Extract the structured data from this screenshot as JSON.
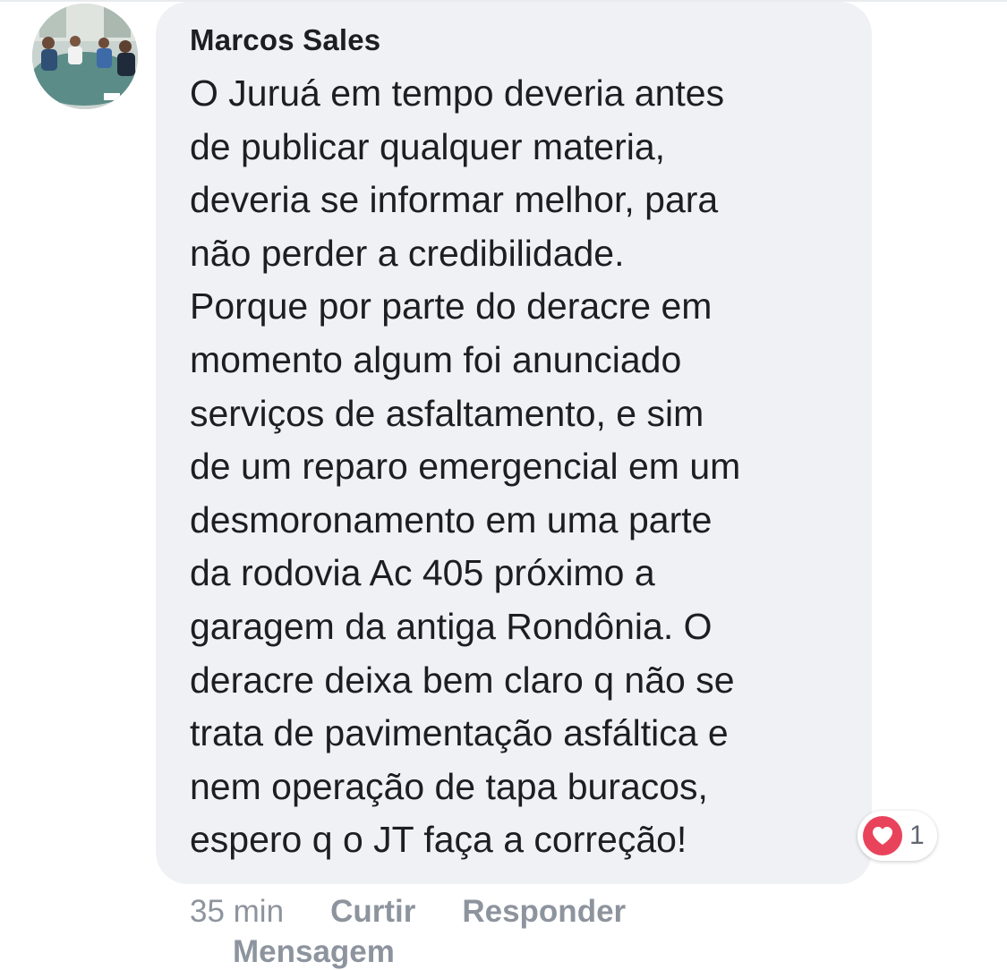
{
  "comment": {
    "author": "Marcos Sales",
    "lines": [
      "O Juruá em tempo deveria antes",
      "de publicar qualquer materia,",
      "deveria se informar melhor, para",
      "não perder a credibilidade.",
      "Porque por parte do deracre em",
      "momento algum foi anunciado",
      "serviços de asfaltamento, e sim",
      "de um reparo emergencial em um",
      "desmoronamento em uma parte",
      "da rodovia Ac 405 próximo a",
      "garagem da antiga Rondônia. O",
      "deracre deixa bem claro q não se",
      "trata de pavimentação asfáltica e",
      "nem operação de tapa buracos,",
      "espero q o JT faça a correção!"
    ],
    "reaction": {
      "icon": "heart-icon",
      "count": "1",
      "color": "#e9435b"
    },
    "actions": {
      "timestamp": "35 min",
      "like_label": "Curtir",
      "reply_label": "Responder",
      "message_label": "Mensagem"
    }
  },
  "colors": {
    "bubble": "#f0f1f4",
    "text": "#1c1e21",
    "muted": "#8d949e"
  }
}
